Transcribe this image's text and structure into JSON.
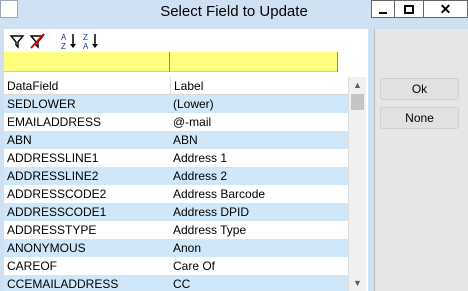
{
  "window": {
    "title": "Select Field to Update",
    "controls": {
      "minimize": "minimize",
      "maximize": "maximize",
      "close": "✕"
    }
  },
  "toolbar": {
    "icons": [
      "filter-icon",
      "clear-filter-icon",
      "sort-ascending-icon",
      "sort-descending-icon"
    ]
  },
  "grid": {
    "columns": [
      "DataField",
      "Label"
    ],
    "rows": [
      [
        "SEDLOWER",
        "(Lower)"
      ],
      [
        "EMAILADDRESS",
        "@-mail"
      ],
      [
        "ABN",
        "ABN"
      ],
      [
        "ADDRESSLINE1",
        "Address 1"
      ],
      [
        "ADDRESSLINE2",
        "Address 2"
      ],
      [
        "ADDRESSCODE2",
        "Address Barcode"
      ],
      [
        "ADDRESSCODE1",
        "Address DPID"
      ],
      [
        "ADDRESSTYPE",
        "Address Type"
      ],
      [
        "ANONYMOUS",
        "Anon"
      ],
      [
        "CAREOF",
        "Care Of"
      ],
      [
        "CCEMAILADDRESS",
        "CC"
      ]
    ],
    "alt_row_color": "#cfe7f8",
    "filter_row_color": "#ffff80"
  },
  "buttons": {
    "ok": "Ok",
    "none": "None"
  }
}
